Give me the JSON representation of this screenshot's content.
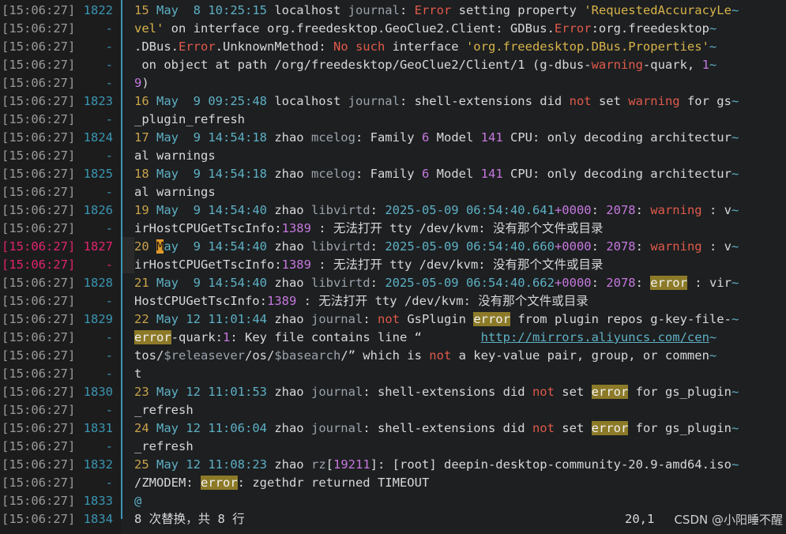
{
  "gutter": {
    "rows": [
      {
        "ts": "[15:06:27]",
        "ln": "1822"
      },
      {
        "ts": "[15:06:27]",
        "ln": "-"
      },
      {
        "ts": "[15:06:27]",
        "ln": "-"
      },
      {
        "ts": "[15:06:27]",
        "ln": "-"
      },
      {
        "ts": "[15:06:27]",
        "ln": "-"
      },
      {
        "ts": "[15:06:27]",
        "ln": "1823"
      },
      {
        "ts": "[15:06:27]",
        "ln": "-"
      },
      {
        "ts": "[15:06:27]",
        "ln": "1824"
      },
      {
        "ts": "[15:06:27]",
        "ln": "-"
      },
      {
        "ts": "[15:06:27]",
        "ln": "1825"
      },
      {
        "ts": "[15:06:27]",
        "ln": "-"
      },
      {
        "ts": "[15:06:27]",
        "ln": "1826"
      },
      {
        "ts": "[15:06:27]",
        "ln": "-"
      },
      {
        "ts": "[15:06:27]",
        "ln": "1827"
      },
      {
        "ts": "[15:06:27]",
        "ln": "-"
      },
      {
        "ts": "[15:06:27]",
        "ln": "1828"
      },
      {
        "ts": "[15:06:27]",
        "ln": "-"
      },
      {
        "ts": "[15:06:27]",
        "ln": "1829"
      },
      {
        "ts": "[15:06:27]",
        "ln": "-"
      },
      {
        "ts": "[15:06:27]",
        "ln": "-"
      },
      {
        "ts": "[15:06:27]",
        "ln": "-"
      },
      {
        "ts": "[15:06:27]",
        "ln": "1830"
      },
      {
        "ts": "[15:06:27]",
        "ln": "-"
      },
      {
        "ts": "[15:06:27]",
        "ln": "1831"
      },
      {
        "ts": "[15:06:27]",
        "ln": "-"
      },
      {
        "ts": "[15:06:27]",
        "ln": "1832"
      },
      {
        "ts": "[15:06:27]",
        "ln": "-"
      },
      {
        "ts": "[15:06:27]",
        "ln": "1833"
      },
      {
        "ts": "[15:06:27]",
        "ln": "1834"
      }
    ],
    "current_index": [
      13,
      14
    ]
  },
  "editor": {
    "lines": [
      [
        [
          "n",
          "15 "
        ],
        [
          "dt",
          "May  8 10:25:15"
        ],
        [
          "",
          " localhost "
        ],
        [
          "p",
          "journal"
        ],
        [
          "",
          ": "
        ],
        [
          "er",
          "Error"
        ],
        [
          "",
          " setting property "
        ],
        [
          "str",
          "'RequestedAccuracyLe"
        ],
        [
          "tilde",
          "~"
        ]
      ],
      [
        [
          "str",
          "vel'"
        ],
        [
          "",
          " on interface org.freedesktop.GeoClue2.Client: GDBus."
        ],
        [
          "er",
          "Error"
        ],
        [
          "",
          ":org.freedesktop"
        ],
        [
          "tilde",
          "~"
        ]
      ],
      [
        [
          "",
          ".DBus."
        ],
        [
          "er",
          "Error"
        ],
        [
          "",
          ".UnknownMethod: "
        ],
        [
          "er",
          "No such"
        ],
        [
          "",
          " interface "
        ],
        [
          "str",
          "'org.freedesktop.DBus.Properties'"
        ],
        [
          "tilde",
          "~"
        ]
      ],
      [
        [
          "",
          " on object at path /org/freedesktop/GeoClue2/Client/1 (g-dbus-"
        ],
        [
          "wn",
          "warning"
        ],
        [
          "",
          "-quark, "
        ],
        [
          "num",
          "1"
        ],
        [
          "tilde",
          "~"
        ]
      ],
      [
        [
          "num",
          "9"
        ],
        [
          "",
          ")"
        ]
      ],
      [
        [
          "n",
          "16 "
        ],
        [
          "dt",
          "May  9 09:25:48"
        ],
        [
          "",
          " localhost "
        ],
        [
          "p",
          "journal"
        ],
        [
          "",
          ": shell-extensions did "
        ],
        [
          "er",
          "not"
        ],
        [
          "",
          " set "
        ],
        [
          "wn",
          "warning"
        ],
        [
          "",
          " for gs"
        ],
        [
          "tilde",
          "~"
        ]
      ],
      [
        [
          "",
          "_plugin_refresh"
        ]
      ],
      [
        [
          "n",
          "17 "
        ],
        [
          "dt",
          "May  9 14:54:18"
        ],
        [
          "",
          " zhao "
        ],
        [
          "p",
          "mcelog"
        ],
        [
          "",
          ": Family "
        ],
        [
          "num",
          "6"
        ],
        [
          "",
          " Model "
        ],
        [
          "num",
          "141"
        ],
        [
          "",
          " CPU: only decoding architectur"
        ],
        [
          "tilde",
          "~"
        ]
      ],
      [
        [
          "",
          "al warnings"
        ]
      ],
      [
        [
          "n",
          "18 "
        ],
        [
          "dt",
          "May  9 14:54:18"
        ],
        [
          "",
          " zhao "
        ],
        [
          "p",
          "mcelog"
        ],
        [
          "",
          ": Family "
        ],
        [
          "num",
          "6"
        ],
        [
          "",
          " Model "
        ],
        [
          "num",
          "141"
        ],
        [
          "",
          " CPU: only decoding architectur"
        ],
        [
          "tilde",
          "~"
        ]
      ],
      [
        [
          "",
          "al warnings"
        ]
      ],
      [
        [
          "n",
          "19 "
        ],
        [
          "dt",
          "May  9 14:54:40"
        ],
        [
          "",
          " zhao "
        ],
        [
          "p",
          "libvirtd"
        ],
        [
          "",
          ": "
        ],
        [
          "dt",
          "2025-05-09 06:54:40.641"
        ],
        [
          "num",
          "+0000"
        ],
        [
          "",
          ": "
        ],
        [
          "num",
          "2078"
        ],
        [
          "",
          ": "
        ],
        [
          "wn",
          "warning"
        ],
        [
          "",
          " : v"
        ],
        [
          "tilde",
          "~"
        ]
      ],
      [
        [
          "",
          "irHostCPUGetTscInfo:"
        ],
        [
          "num",
          "1389"
        ],
        [
          "",
          " : 无法打开 tty /dev/kvm: 没有那个文件或目录"
        ]
      ],
      [
        [
          "n",
          "20 "
        ],
        [
          "caret",
          "M"
        ],
        [
          "dt",
          "ay  9 14:54:40"
        ],
        [
          "",
          " zhao "
        ],
        [
          "p",
          "libvirtd"
        ],
        [
          "",
          ": "
        ],
        [
          "dt",
          "2025-05-09 06:54:40.660"
        ],
        [
          "num",
          "+0000"
        ],
        [
          "",
          ": "
        ],
        [
          "num",
          "2078"
        ],
        [
          "",
          ": "
        ],
        [
          "wn",
          "warning"
        ],
        [
          "",
          " : v"
        ],
        [
          "tilde",
          "~"
        ]
      ],
      [
        [
          "",
          "irHostCPUGetTscInfo:"
        ],
        [
          "num",
          "1389"
        ],
        [
          "",
          " : 无法打开 tty /dev/kvm: 没有那个文件或目录"
        ]
      ],
      [
        [
          "n",
          "21 "
        ],
        [
          "dt",
          "May  9 14:54:40"
        ],
        [
          "",
          " zhao "
        ],
        [
          "p",
          "libvirtd"
        ],
        [
          "",
          ": "
        ],
        [
          "dt",
          "2025-05-09 06:54:40.662"
        ],
        [
          "num",
          "+0000"
        ],
        [
          "",
          ": "
        ],
        [
          "num",
          "2078"
        ],
        [
          "",
          ": "
        ],
        [
          "hl",
          "error"
        ],
        [
          "",
          " : vir"
        ],
        [
          "tilde",
          "~"
        ]
      ],
      [
        [
          "",
          "HostCPUGetTscInfo:"
        ],
        [
          "num",
          "1389"
        ],
        [
          "",
          " : 无法打开 tty /dev/kvm: 没有那个文件或目录"
        ]
      ],
      [
        [
          "n",
          "22 "
        ],
        [
          "dt",
          "May 12 11:01:44"
        ],
        [
          "",
          " zhao "
        ],
        [
          "p",
          "journal"
        ],
        [
          "",
          ": "
        ],
        [
          "er",
          "not"
        ],
        [
          "",
          " GsPlugin "
        ],
        [
          "hl",
          "error"
        ],
        [
          "",
          " from plugin repos g-key-file-"
        ],
        [
          "tilde",
          "~"
        ]
      ],
      [
        [
          "hl",
          "error"
        ],
        [
          "",
          "-quark:"
        ],
        [
          "num",
          "1"
        ],
        [
          "",
          ": Key file contains line “        "
        ],
        [
          "url",
          "http://mirrors.aliyuncs.com/cen"
        ],
        [
          "tilde",
          "~"
        ]
      ],
      [
        [
          "",
          "tos/"
        ],
        [
          "p",
          "$releasever"
        ],
        [
          "",
          "/os/"
        ],
        [
          "p",
          "$basearch"
        ],
        [
          "",
          "/” which is "
        ],
        [
          "er",
          "not"
        ],
        [
          "",
          " a key-value pair, group, or commen"
        ],
        [
          "tilde",
          "~"
        ]
      ],
      [
        [
          "",
          "t"
        ]
      ],
      [
        [
          "n",
          "23 "
        ],
        [
          "dt",
          "May 12 11:01:53"
        ],
        [
          "",
          " zhao "
        ],
        [
          "p",
          "journal"
        ],
        [
          "",
          ": shell-extensions did "
        ],
        [
          "er",
          "not"
        ],
        [
          "",
          " set "
        ],
        [
          "hl",
          "error"
        ],
        [
          "",
          " for gs_plugin"
        ],
        [
          "tilde",
          "~"
        ]
      ],
      [
        [
          "",
          "_refresh"
        ]
      ],
      [
        [
          "n",
          "24 "
        ],
        [
          "dt",
          "May 12 11:06:04"
        ],
        [
          "",
          " zhao "
        ],
        [
          "p",
          "journal"
        ],
        [
          "",
          ": shell-extensions did "
        ],
        [
          "er",
          "not"
        ],
        [
          "",
          " set "
        ],
        [
          "hl",
          "error"
        ],
        [
          "",
          " for gs_plugin"
        ],
        [
          "tilde",
          "~"
        ]
      ],
      [
        [
          "",
          "_refresh"
        ]
      ],
      [
        [
          "n",
          "25 "
        ],
        [
          "dt",
          "May 12 11:08:23"
        ],
        [
          "",
          " zhao "
        ],
        [
          "p",
          "rz"
        ],
        [
          "",
          "["
        ],
        [
          "num",
          "19211"
        ],
        [
          "",
          "]: [root] deepin-desktop-community-20.9-amd64.iso"
        ],
        [
          "tilde",
          "~"
        ]
      ],
      [
        [
          "",
          "/ZMODEM: "
        ],
        [
          "hl",
          "error"
        ],
        [
          "",
          ": zgethdr returned TIMEOUT"
        ]
      ],
      [
        [
          "tilde",
          "@"
        ]
      ]
    ]
  },
  "status": {
    "message": "8 次替换，共 8 行",
    "position": "20,1",
    "watermark": "CSDN @小阳睡不醒"
  },
  "colors": {
    "background": "#1d1f21",
    "accent_teal": "#3a95b3",
    "current_line_pink": "#e0246e",
    "search_highlight": "#8c7a28",
    "error_red": "#e05a4a"
  }
}
